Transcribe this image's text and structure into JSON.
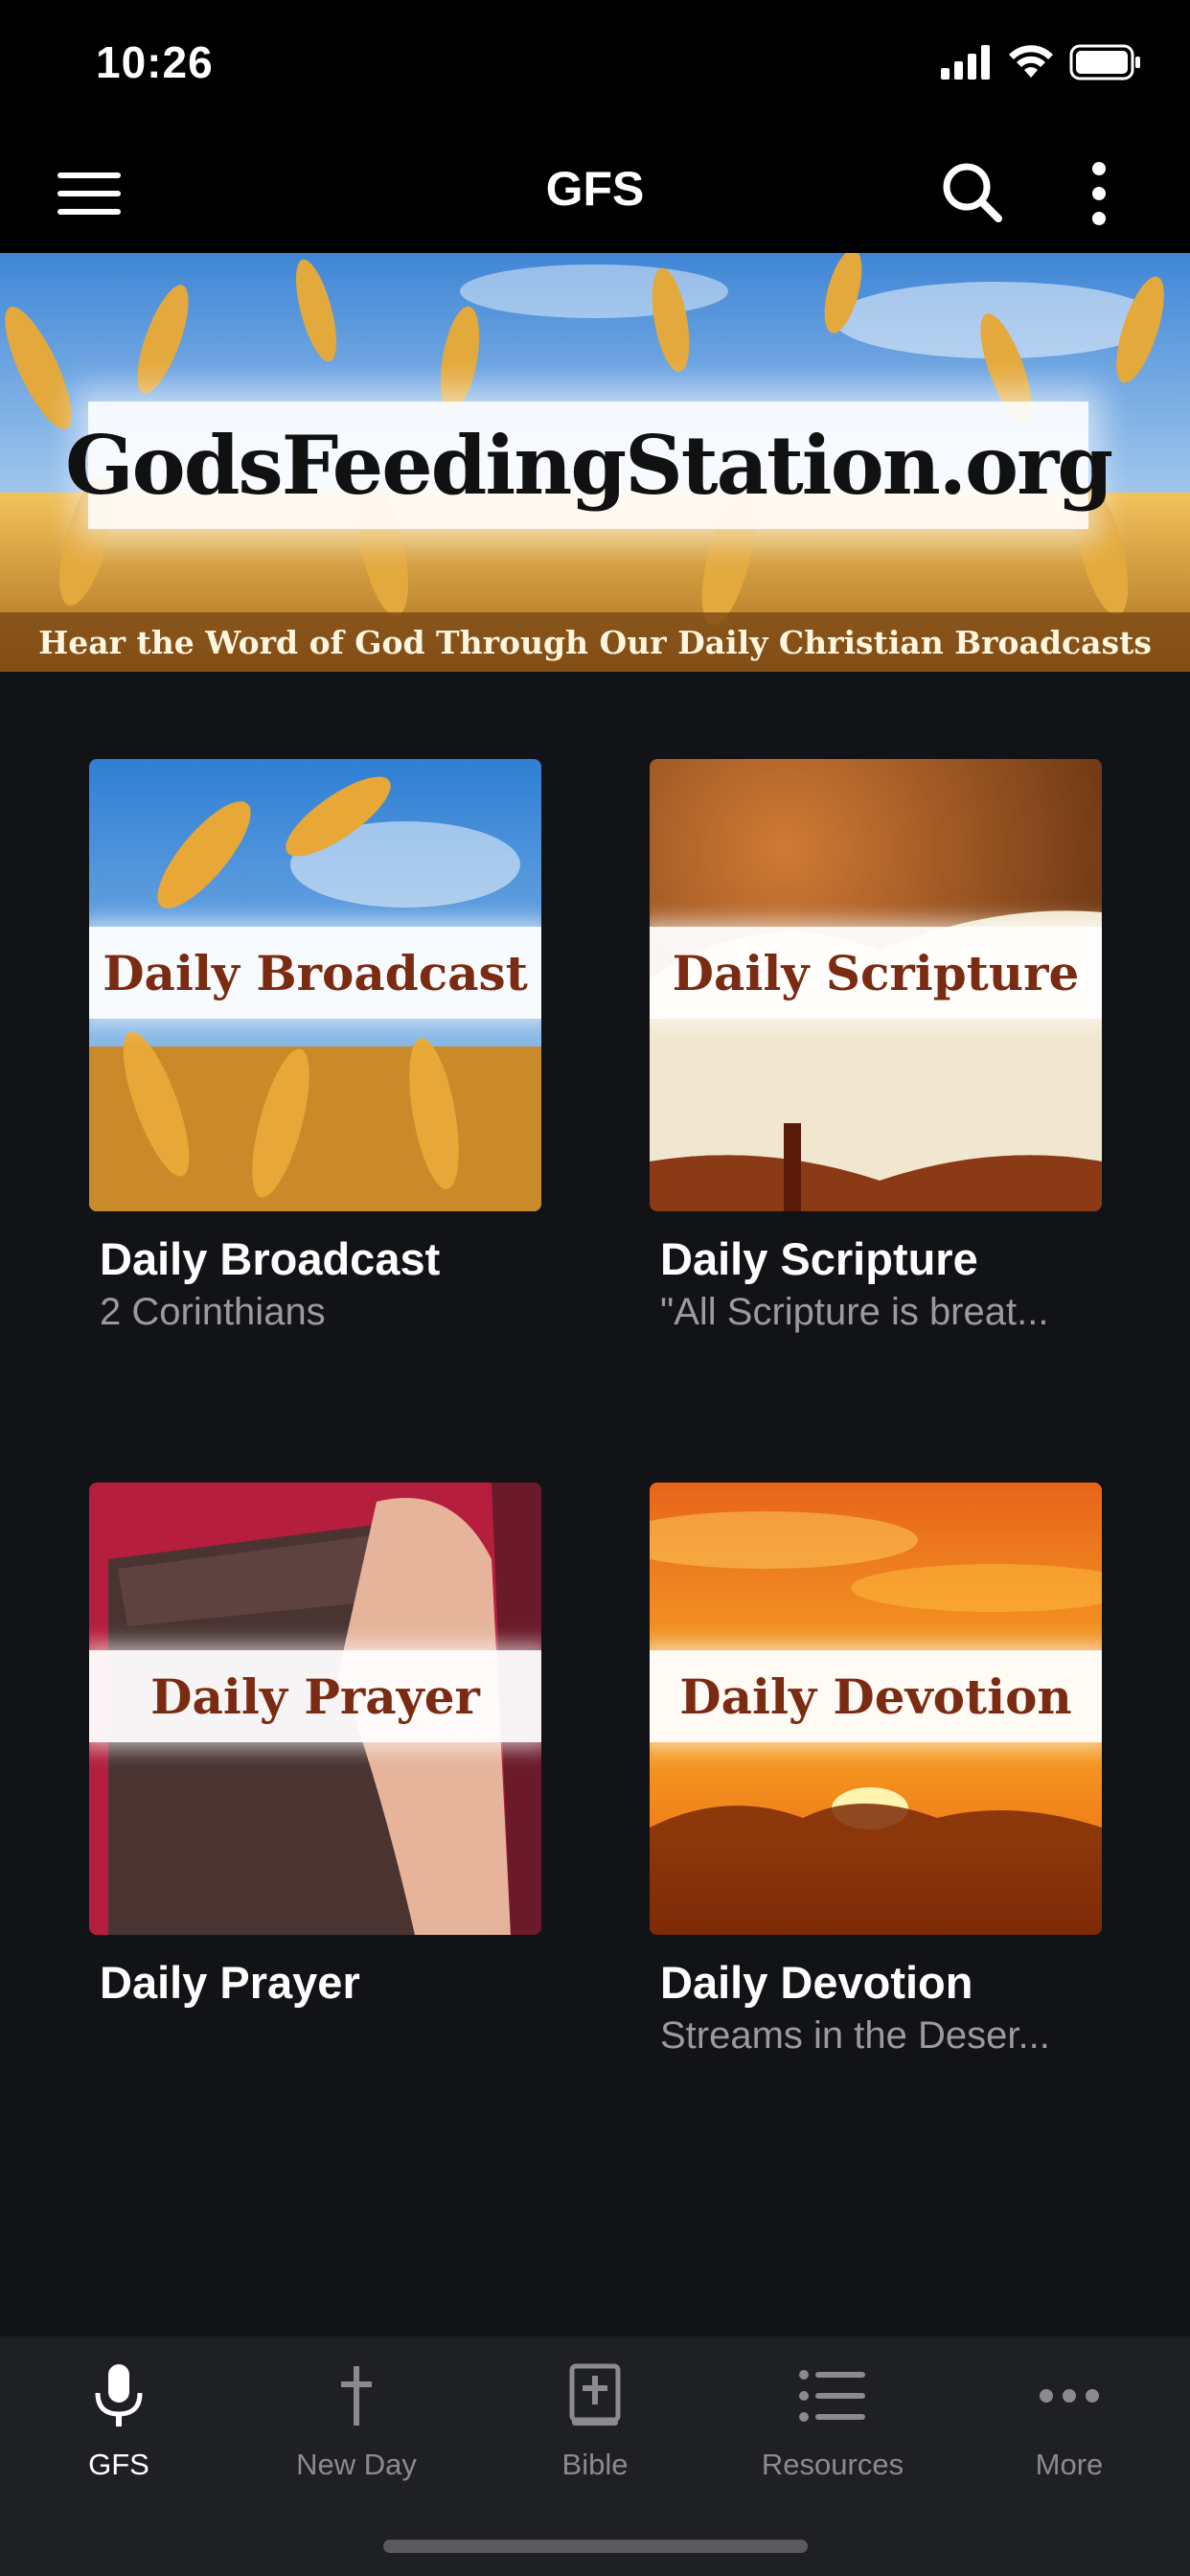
{
  "status_bar": {
    "time": "10:26"
  },
  "header": {
    "title": "GFS"
  },
  "banner": {
    "title": "GodsFeedingStation.org",
    "subtitle": "Hear the Word of God Through Our Daily Christian Broadcasts"
  },
  "cards": [
    {
      "image_label": "Daily Broadcast",
      "title": "Daily Broadcast",
      "subtitle": "2 Corinthians"
    },
    {
      "image_label": "Daily Scripture",
      "title": "Daily Scripture",
      "subtitle": "\"All Scripture is breat..."
    },
    {
      "image_label": "Daily Prayer",
      "title": "Daily Prayer",
      "subtitle": ""
    },
    {
      "image_label": "Daily Devotion",
      "title": "Daily Devotion",
      "subtitle": "Streams in the Deser..."
    }
  ],
  "bottom_nav": [
    {
      "label": "GFS",
      "icon": "microphone-icon",
      "active": true
    },
    {
      "label": "New Day",
      "icon": "cross-icon",
      "active": false
    },
    {
      "label": "Bible",
      "icon": "bible-icon",
      "active": false
    },
    {
      "label": "Resources",
      "icon": "list-icon",
      "active": false
    },
    {
      "label": "More",
      "icon": "more-horizontal-icon",
      "active": false
    }
  ],
  "colors": {
    "background": "#121316",
    "bar": "#000000",
    "nav_background": "#1f2023",
    "label_brown": "#7a2b12",
    "muted_text": "#9a9aa0"
  }
}
